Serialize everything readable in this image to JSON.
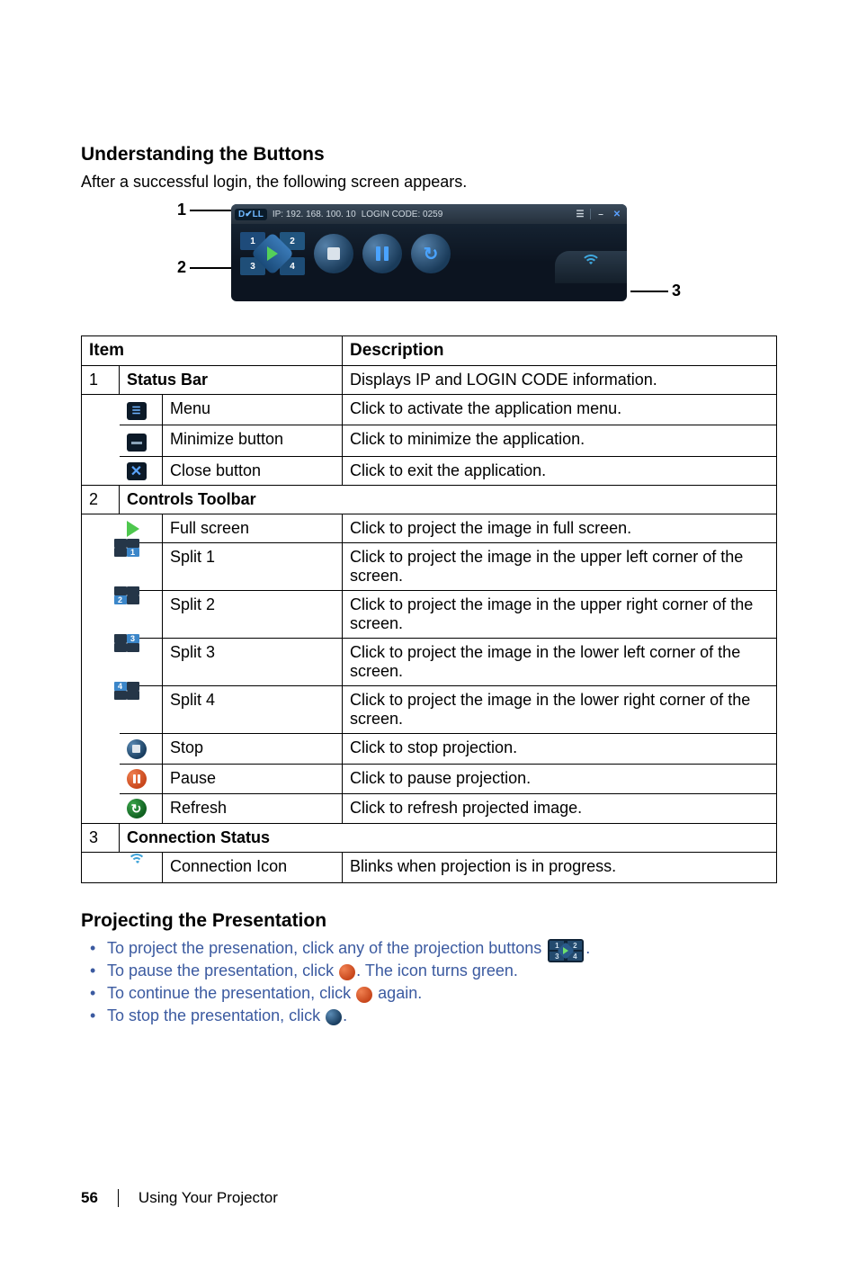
{
  "section1_heading": "Understanding the Buttons",
  "section1_intro": "After a successful login, the following screen appears.",
  "callouts": {
    "c1": "1",
    "c2": "2",
    "c3": "3"
  },
  "titlebar": {
    "brand": "D✔LL",
    "ip": "IP: 192. 168. 100. 10",
    "login": "LOGIN CODE: 0259"
  },
  "table": {
    "head_item": "Item",
    "head_desc": "Description",
    "row1": {
      "num": "1",
      "name": "Status Bar",
      "desc": "Displays IP and LOGIN CODE information."
    },
    "row1a": {
      "name": "Menu",
      "desc": "Click to activate the application menu."
    },
    "row1b": {
      "name": "Minimize button",
      "desc": "Click to minimize the application."
    },
    "row1c": {
      "name": "Close button",
      "desc": "Click to exit the application."
    },
    "row2": {
      "num": "2",
      "name": "Controls Toolbar"
    },
    "row2a": {
      "name": "Full screen",
      "desc": "Click to project the image in full screen."
    },
    "row2b": {
      "name": "Split 1",
      "desc": "Click to project the image in the upper left corner of the screen."
    },
    "row2c": {
      "name": "Split 2",
      "desc": "Click to project the image in the upper right corner of the screen."
    },
    "row2d": {
      "name": "Split 3",
      "desc": "Click to project the image in the lower left corner of the screen."
    },
    "row2e": {
      "name": "Split 4",
      "desc": "Click to project the image in the lower right corner of the screen."
    },
    "row2f": {
      "name": "Stop",
      "desc": "Click to stop projection."
    },
    "row2g": {
      "name": "Pause",
      "desc": "Click to pause projection."
    },
    "row2h": {
      "name": "Refresh",
      "desc": "Click to refresh projected image."
    },
    "row3": {
      "num": "3",
      "name": "Connection Status"
    },
    "row3a": {
      "name": "Connection Icon",
      "desc": "Blinks when projection is in progress."
    }
  },
  "section2_heading": "Projecting the Presentation",
  "bullets": {
    "b1a": "To project the presenation, click any of the projection buttons ",
    "b1b": ".",
    "b2a": "To pause the presentation, click ",
    "b2b": ". The icon turns green.",
    "b3a": "To continue the presentation, click ",
    "b3b": " again.",
    "b4a": "To stop the presentation, click ",
    "b4b": "."
  },
  "footer": {
    "page": "56",
    "title": "Using Your Projector"
  }
}
